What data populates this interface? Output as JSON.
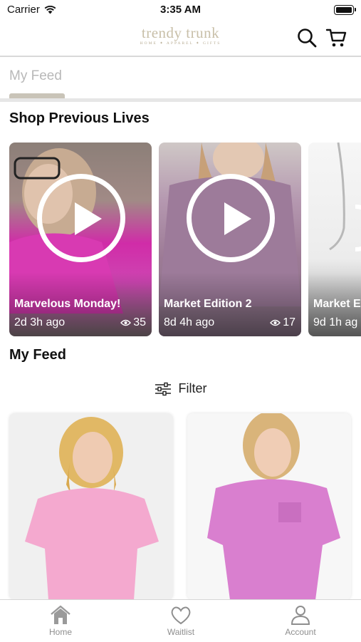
{
  "status_bar": {
    "carrier": "Carrier",
    "time": "3:35 AM"
  },
  "header": {
    "logo_name": "trendy trunk",
    "logo_tagline": "HOME ✦ APPAREL ✦ GIFTS"
  },
  "tabs": [
    {
      "label": "My Feed",
      "selected": true
    }
  ],
  "previous_lives": {
    "title": "Shop Previous Lives",
    "items": [
      {
        "title": "Marvelous Monday!",
        "ago": "2d 3h ago",
        "views": "35"
      },
      {
        "title": "Market Edition 2",
        "ago": "8d 4h ago",
        "views": "17"
      },
      {
        "title": "Market E",
        "ago": "9d 1h ag",
        "views": ""
      }
    ]
  },
  "feed": {
    "title": "My Feed",
    "filter_label": "Filter"
  },
  "bottom_nav": [
    {
      "label": "Home",
      "icon": "home-icon"
    },
    {
      "label": "Waitlist",
      "icon": "heart-icon"
    },
    {
      "label": "Account",
      "icon": "person-icon"
    }
  ],
  "colors": {
    "accent": "#c9c4b8",
    "logo": "#c8bfa8",
    "pink_top": "#f2a7cf",
    "magenta_top": "#d77ad0"
  }
}
